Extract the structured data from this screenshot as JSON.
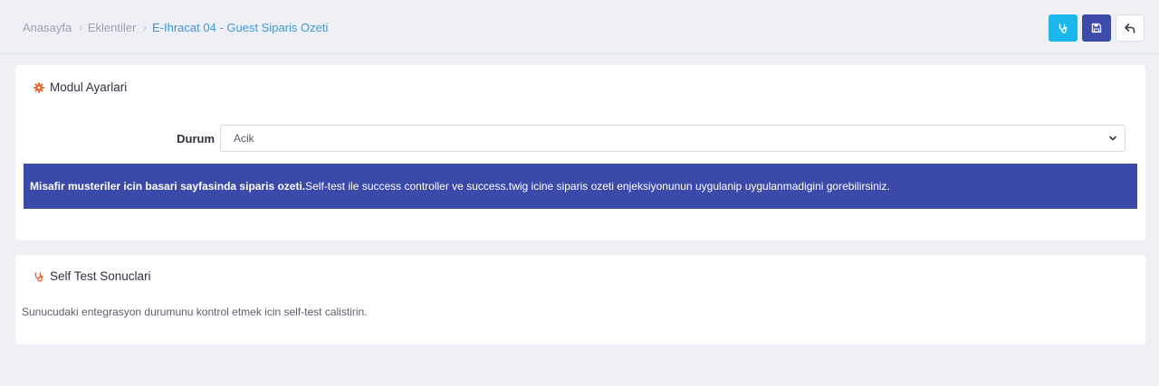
{
  "breadcrumb": {
    "items": [
      "Anasayfa",
      "Eklentiler"
    ],
    "separator": "›",
    "current": "E-Ihracat 04 - Guest Siparis Ozeti"
  },
  "actions": {
    "selftest_icon": "stethoscope-icon",
    "save_icon": "save-icon",
    "back_icon": "undo-icon",
    "colors": {
      "info": "#1ab7ea",
      "primary": "#3d4aa8"
    }
  },
  "module_settings": {
    "title": "Modul Ayarlari",
    "title_icon": "gear-icon",
    "status_label": "Durum",
    "status_value": "Acik",
    "alert": {
      "strong": "Misafir musteriler icin basari sayfasinda siparis ozeti.",
      "text": "Self-test ile success controller ve success.twig icine siparis ozeti enjeksiyonunun uygulanip uygulanmadigini gorebilirsiniz.",
      "background": "#3b4aa8"
    }
  },
  "self_test": {
    "title": "Self Test Sonuclari",
    "title_icon": "stethoscope-icon",
    "description": "Sunucudaki entegrasyon durumunu kontrol etmek icin self-test calistirin."
  }
}
